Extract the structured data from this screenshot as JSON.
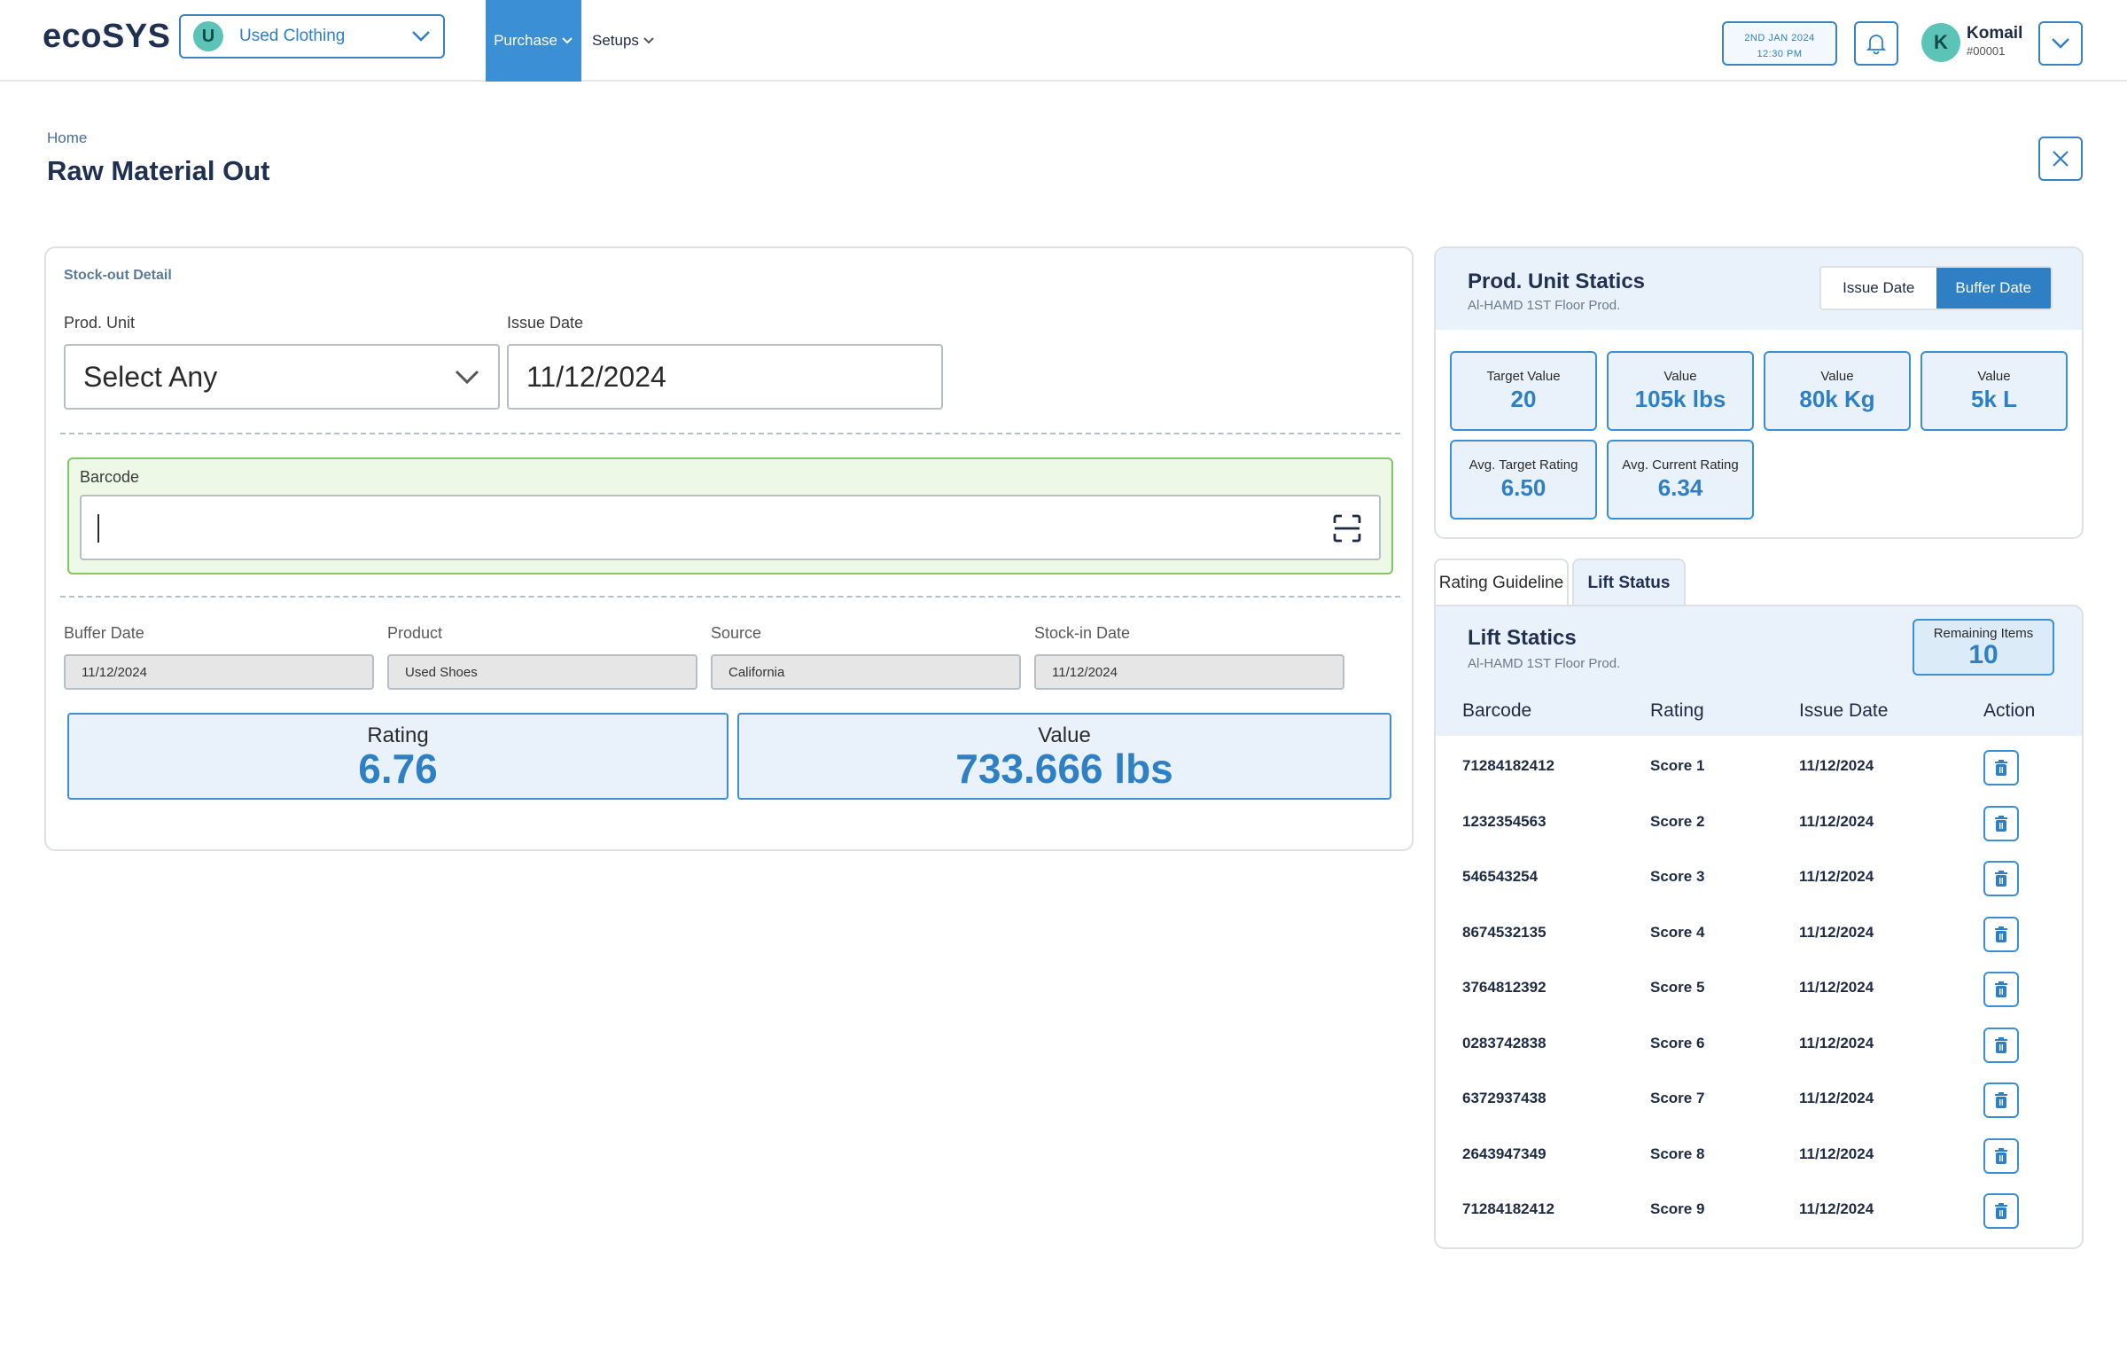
{
  "header": {
    "logo": "ecoSYS",
    "org": {
      "initial": "U",
      "label": "Used Clothing"
    },
    "nav": {
      "purchase": "Purchase",
      "setups": "Setups"
    },
    "date_line1": "2ND JAN 2024",
    "date_line2": "12:30 PM",
    "user": {
      "initial": "K",
      "name": "Komail",
      "id": "#00001"
    }
  },
  "page": {
    "breadcrumb": "Home",
    "title": "Raw Material Out"
  },
  "stockout": {
    "section_title": "Stock-out Detail",
    "prod_unit_label": "Prod. Unit",
    "prod_unit_value": "Select Any",
    "issue_date_label": "Issue Date",
    "issue_date_value": "11/12/2024",
    "barcode_label": "Barcode",
    "fields": [
      {
        "label": "Buffer Date",
        "value": "11/12/2024"
      },
      {
        "label": "Product",
        "value": "Used Shoes"
      },
      {
        "label": "Source",
        "value": "California"
      },
      {
        "label": "Stock-in Date",
        "value": "11/12/2024"
      }
    ],
    "rating": {
      "title": "Rating",
      "value": "6.76"
    },
    "value": {
      "title": "Value",
      "value": "733.666 lbs"
    }
  },
  "prod_stats": {
    "title": "Prod. Unit Statics",
    "subtitle": "Al-HAMD 1ST Floor Prod.",
    "toggle": {
      "issue_date": "Issue Date",
      "buffer_date": "Buffer Date"
    },
    "cards": [
      {
        "title": "Target Value",
        "value": "20"
      },
      {
        "title": "Value",
        "value": "105k lbs"
      },
      {
        "title": "Value",
        "value": "80k Kg"
      },
      {
        "title": "Value",
        "value": "5k L"
      },
      {
        "title": "Avg. Target Rating",
        "value": "6.50"
      },
      {
        "title": "Avg. Current Rating",
        "value": "6.34"
      }
    ]
  },
  "tabs": {
    "rating_guideline": "Rating Guideline",
    "lift_status": "Lift Status"
  },
  "lift": {
    "title": "Lift Statics",
    "subtitle": "Al-HAMD 1ST Floor Prod.",
    "remaining_label": "Remaining Items",
    "remaining_value": "10",
    "columns": [
      "Barcode",
      "Rating",
      "Issue Date",
      "Action"
    ],
    "rows": [
      {
        "barcode": "71284182412",
        "rating": "Score 1",
        "date": "11/12/2024"
      },
      {
        "barcode": "1232354563",
        "rating": "Score 2",
        "date": "11/12/2024"
      },
      {
        "barcode": "546543254",
        "rating": "Score 3",
        "date": "11/12/2024"
      },
      {
        "barcode": "8674532135",
        "rating": "Score 4",
        "date": "11/12/2024"
      },
      {
        "barcode": "3764812392",
        "rating": "Score 5",
        "date": "11/12/2024"
      },
      {
        "barcode": "0283742838",
        "rating": "Score 6",
        "date": "11/12/2024"
      },
      {
        "barcode": "6372937438",
        "rating": "Score 7",
        "date": "11/12/2024"
      },
      {
        "barcode": "2643947349",
        "rating": "Score 8",
        "date": "11/12/2024"
      },
      {
        "barcode": "71284182412",
        "rating": "Score 9",
        "date": "11/12/2024"
      }
    ]
  },
  "colors": {
    "accent": "#2f7fc4",
    "accent_light": "#e9f2fb",
    "barcode_border": "#7ccb5c",
    "teal_avatar": "#5cc3b8"
  },
  "icons": {
    "org_dropdown": "chevron-down-icon",
    "bell": "bell-icon",
    "close": "close-icon",
    "scan": "scan-icon",
    "delete": "trash-icon"
  }
}
